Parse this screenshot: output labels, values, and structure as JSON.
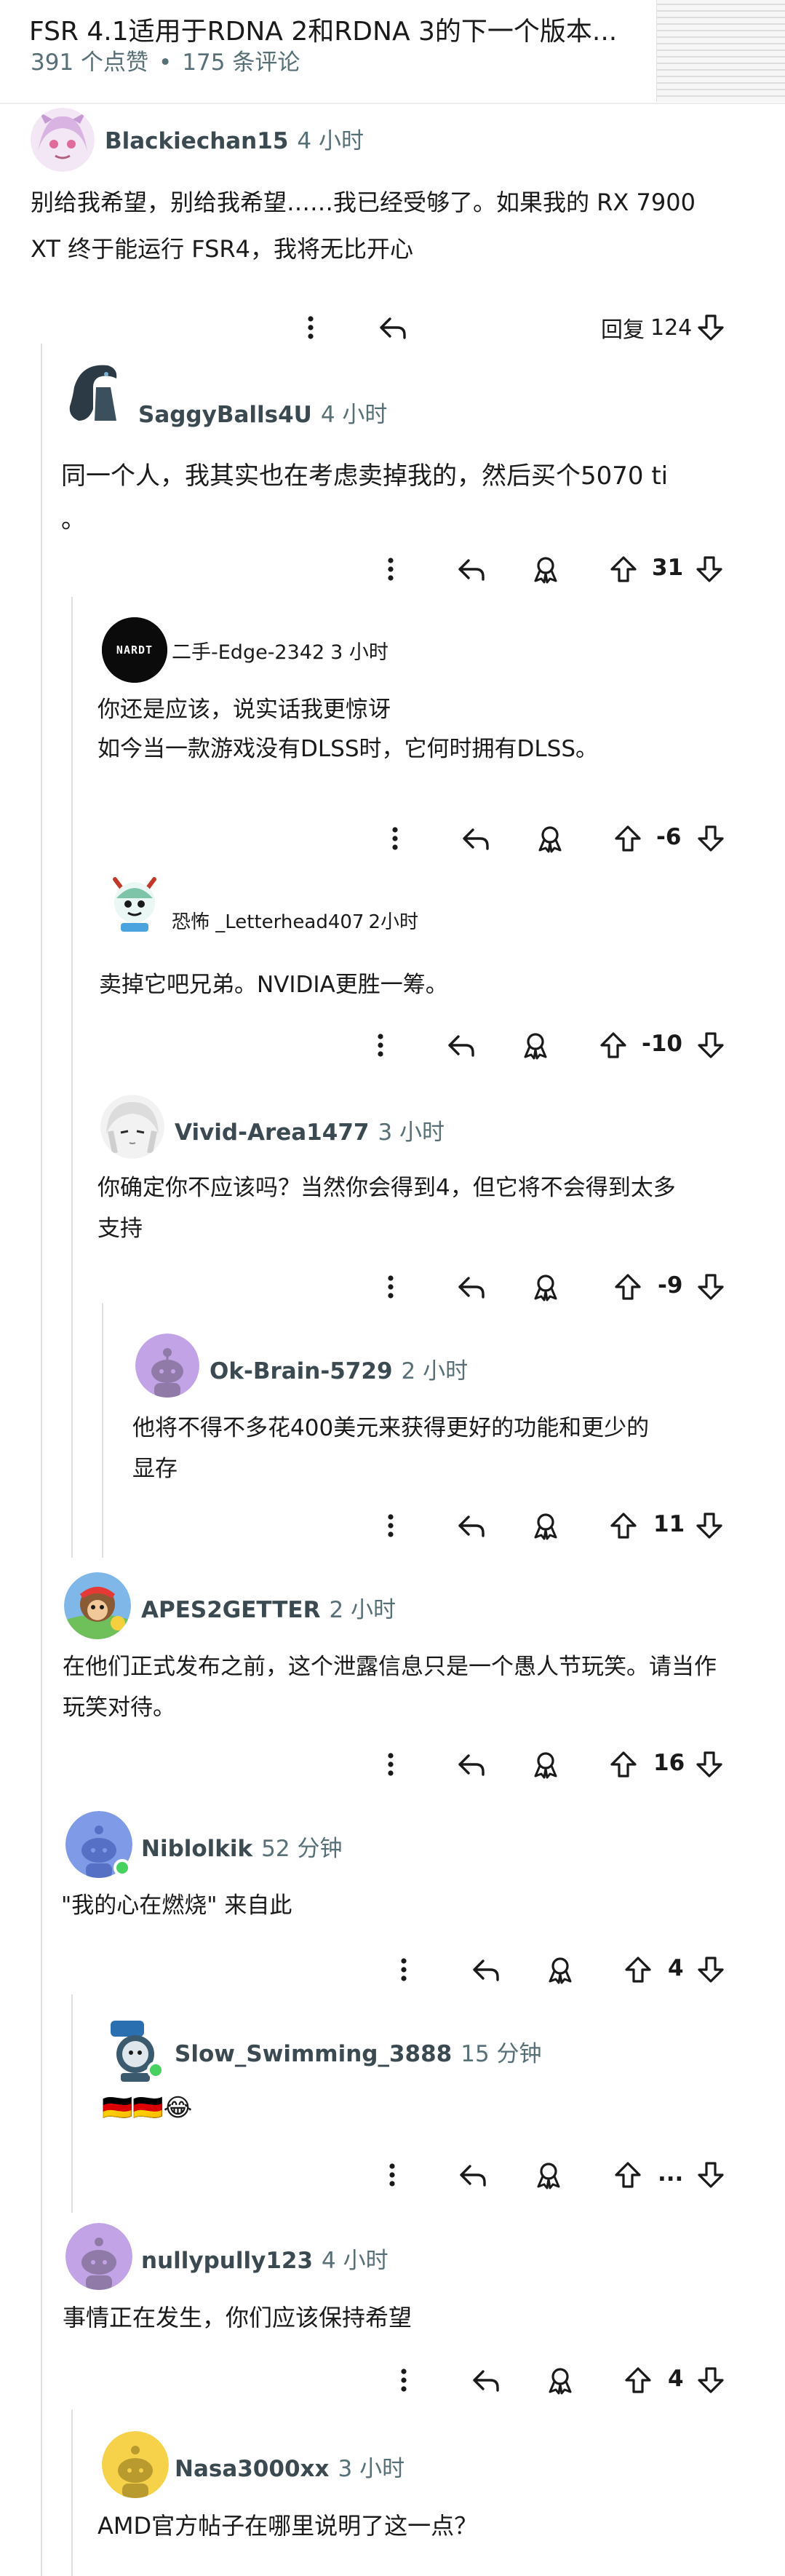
{
  "post": {
    "title": "FSR 4.1适用于RDNA 2和RDNA 3的下一个版本...",
    "upvotes": "391 个点赞",
    "separator": "•",
    "comment_count": "175 条评论"
  },
  "comments": [
    {
      "author": "Blackiechan15",
      "time": "4 小时",
      "body": "别给我希望，别给我希望……我已经受够了。如果我的 RX 7900\nXT 终于能运行 FSR4，我将无比开心",
      "reply_label": "回复",
      "reply_count": "124"
    },
    {
      "author": "SaggyBalls4U",
      "time": "4 小时",
      "body": "同一个人，我其实也在考虑卖掉我的，然后买个5070 ti\n。",
      "votes": "31"
    },
    {
      "author": "二手-Edge-2342",
      "time": "3 小时",
      "body": "你还是应该，说实话我更惊讶\n如今当一款游戏没有DLSS时，它何时拥有DLSS。",
      "votes": "-6",
      "avatar_text": "NARDT"
    },
    {
      "author": "恐怖 _Letterhead407",
      "time": "2小时",
      "body": "卖掉它吧兄弟。NVIDIA更胜一筹。",
      "votes": "-10"
    },
    {
      "author": "Vivid-Area1477",
      "time": "3 小时",
      "body": "你确定你不应该吗？当然你会得到4，但它将不会得到太多\n支持",
      "votes": "-9"
    },
    {
      "author": "Ok-Brain-5729",
      "time": "2 小时",
      "body": "他将不得不多花400美元来获得更好的功能和更少的\n显存",
      "votes": "11"
    },
    {
      "author": "APES2GETTER",
      "time": "2 小时",
      "body": "在他们正式发布之前，这个泄露信息只是一个愚人节玩笑。请当作\n玩笑对待。",
      "votes": "16"
    },
    {
      "author": "Niblolkik",
      "time": "52 分钟",
      "body": "\"我的心在燃烧\" 来自此",
      "votes": "4"
    },
    {
      "author": "Slow_Swimming_3888",
      "time": "15 分钟",
      "body": "🇩🇪🇩🇪😂",
      "votes": "..."
    },
    {
      "author": "nullypully123",
      "time": "4 小时",
      "body": "事情正在发生，你们应该保持希望",
      "votes": "4"
    },
    {
      "author": "Nasa3000xx",
      "time": "3 小时",
      "body": "AMD官方帖子在哪里说明了这一点？"
    }
  ],
  "icons": {
    "more": "more-options-icon",
    "reply": "reply-arrow-icon",
    "award": "award-icon",
    "upvote": "upvote-arrow-icon",
    "downvote": "downvote-arrow-icon"
  },
  "colors": {
    "text": "#1a1a1b",
    "meta": "#576f76",
    "author": "#3b4a51",
    "thread_line": "#e0e0e0",
    "online": "#46d160",
    "snoo_purple": "#c2a3e6",
    "snoo_blue": "#7f9be8",
    "snoo_yellow": "#f5d24a"
  }
}
